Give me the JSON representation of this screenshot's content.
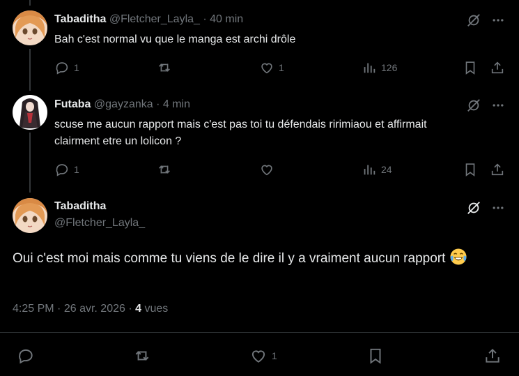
{
  "replies": [
    {
      "name": "Tabaditha",
      "handle": "@Fletcher_Layla_",
      "dot": "·",
      "time": "40 min",
      "text": "Bah c'est normal vu que le manga est archi drôle",
      "reply_count": "1",
      "repost_count": "",
      "like_count": "1",
      "view_count": "126"
    },
    {
      "name": "Futaba",
      "handle": "@gayzanka",
      "dot": "·",
      "time": "4 min",
      "text": "scuse me aucun rapport mais c'est pas toi tu défendais ririmiaou et affirmait clairment etre un lolicon ?",
      "reply_count": "1",
      "repost_count": "",
      "like_count": "",
      "view_count": "24"
    }
  ],
  "main": {
    "name": "Tabaditha",
    "handle": "@Fletcher_Layla_",
    "text": "Oui c'est moi mais comme tu viens de le dire il y a vraiment aucun rapport",
    "time": "4:25 PM",
    "sep1": "·",
    "date": "26 avr. 2026",
    "sep2": "·",
    "views": "4",
    "views_label": "vues",
    "reply_count": "",
    "repost_count": "",
    "like_count": "1"
  },
  "icons": {
    "grok": "grok-slash-icon",
    "more": "more-dots-icon",
    "reply": "reply-bubble-icon",
    "repost": "repost-arrows-icon",
    "like": "heart-icon",
    "views": "bar-chart-icon",
    "bookmark": "bookmark-icon",
    "share": "share-upload-icon",
    "emoji": "face-with-tears-of-joy"
  },
  "colors": {
    "background": "#000000",
    "text": "#e7e9ea",
    "secondary": "#71767b",
    "divider": "#2f3336"
  }
}
